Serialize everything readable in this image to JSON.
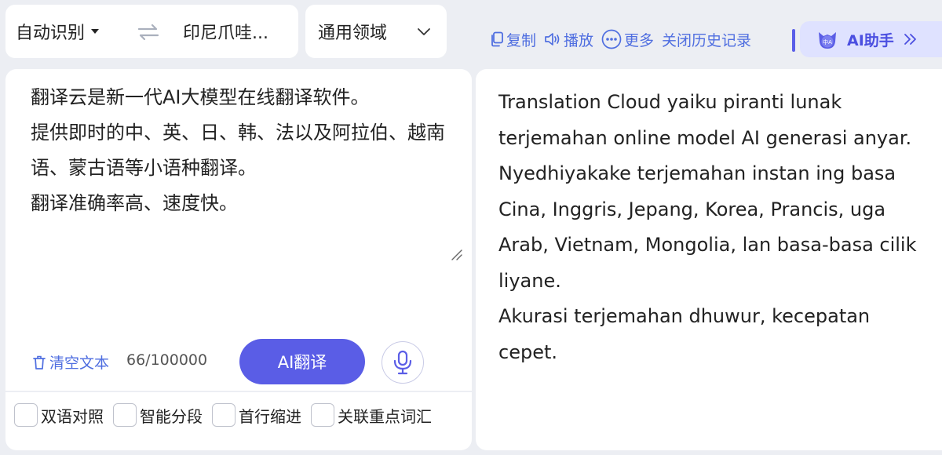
{
  "language_bar": {
    "source_language": "自动识别",
    "target_language": "印尼爪哇...",
    "domain": "通用领域"
  },
  "toolbar": {
    "copy_label": "复制",
    "play_label": "播放",
    "more_label": "更多",
    "close_history_label": "关闭历史记录"
  },
  "ai_assistant": {
    "label": "AI助手",
    "avatar_text": "中A"
  },
  "source": {
    "text": "翻译云是新一代AI大模型在线翻译软件。\n提供即时的中、英、日、韩、法以及阿拉伯、越南语、蒙古语等小语种翻译。\n翻译准确率高、速度快。",
    "clear_label": "清空文本",
    "char_count": "66/100000",
    "translate_button": "AI翻译"
  },
  "options": [
    {
      "label": "双语对照",
      "checked": false
    },
    {
      "label": "智能分段",
      "checked": false
    },
    {
      "label": "首行缩进",
      "checked": false
    },
    {
      "label": "关联重点词汇",
      "checked": false
    }
  ],
  "target": {
    "text": "Translation Cloud yaiku piranti lunak terjemahan online model AI generasi anyar.\nNyedhiyakake terjemahan instan ing basa Cina, Inggris, Jepang, Korea, Prancis, uga Arab, Vietnam, Mongolia, lan basa-basa cilik liyane.\nAkurasi terjemahan dhuwur, kecepatan cepet."
  },
  "colors": {
    "accent": "#5a5de6",
    "link": "#4f6ee0",
    "page_background": "#eceef3",
    "assistant_background": "#dfe2ff"
  }
}
